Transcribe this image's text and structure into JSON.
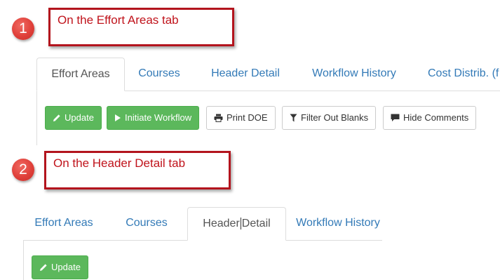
{
  "step1": {
    "badge": "1",
    "callout": "On the Effort Areas tab",
    "tabs": [
      {
        "label": "Effort Areas",
        "active": true
      },
      {
        "label": "Courses",
        "active": false
      },
      {
        "label": "Header Detail",
        "active": false
      },
      {
        "label": "Workflow History",
        "active": false
      },
      {
        "label": "Cost Distrib. (f",
        "active": false
      }
    ],
    "buttons": {
      "update": "Update",
      "initiate_workflow": "Initiate Workflow",
      "print_doe": "Print DOE",
      "filter_out_blanks": "Filter Out Blanks",
      "hide_comments": "Hide Comments"
    }
  },
  "step2": {
    "badge": "2",
    "callout": "On the Header Detail tab",
    "tabs": [
      {
        "label": "Effort Areas",
        "active": false
      },
      {
        "label": "Courses",
        "active": false
      },
      {
        "label_before_cursor": "Header",
        "label_after_cursor": "Detail",
        "active": true
      },
      {
        "label": "Workflow History",
        "active": false
      }
    ],
    "buttons": {
      "update": "Update"
    }
  },
  "colors": {
    "badge_red": "#e0403a",
    "callout_border": "#b3141d",
    "callout_text": "#c0131b",
    "tab_link": "#337ab7",
    "tab_active": "#555555",
    "btn_green": "#5cb85c"
  }
}
